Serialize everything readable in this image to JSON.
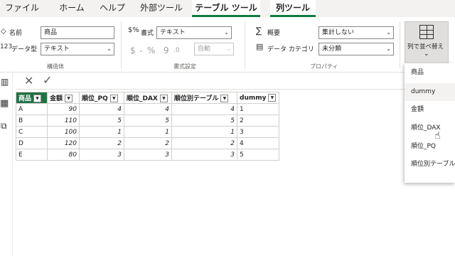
{
  "tabs": [
    "ファイル",
    "ホーム",
    "ヘルプ",
    "外部ツール",
    "テーブル ツール",
    "列ツール"
  ],
  "ribbon": {
    "name_label": "名前",
    "name_value": "商品",
    "datatype_label": "データ型",
    "datatype_value": "テキスト",
    "structure_group": "構造体",
    "format_label": "書式",
    "format_value": "テキスト",
    "currency_symbol": "$",
    "percent_symbol": "%",
    "comma_symbol": "9",
    "decimal_symbol": ".0",
    "auto_value": "自動",
    "format_group": "書式設定",
    "summary_label": "概要",
    "summary_value": "集計しない",
    "category_label": "データ カテゴリ",
    "category_value": "未分類",
    "properties_group": "プロパティ",
    "sort_by_column": "列で並べ替え"
  },
  "toolbar": {
    "cancel": "✕",
    "confirm": "✓"
  },
  "table": {
    "columns": [
      "商品",
      "金額",
      "順位_PQ",
      "順位_DAX",
      "順位別テーブル",
      "dummy"
    ],
    "rows": [
      [
        "A",
        "90",
        "4",
        "4",
        "4",
        "1"
      ],
      [
        "B",
        "110",
        "5",
        "5",
        "5",
        "2"
      ],
      [
        "C",
        "100",
        "1",
        "1",
        "1",
        "3"
      ],
      [
        "D",
        "120",
        "2",
        "2",
        "2",
        "4"
      ],
      [
        "E",
        "80",
        "3",
        "3",
        "3",
        "5"
      ]
    ]
  },
  "sort_menu": [
    "商品",
    "dummy",
    "金額",
    "順位_DAX",
    "順位_PQ",
    "順位別テーブル"
  ],
  "colors": {
    "accent": "#217346",
    "tab_underline": "#107c41"
  }
}
